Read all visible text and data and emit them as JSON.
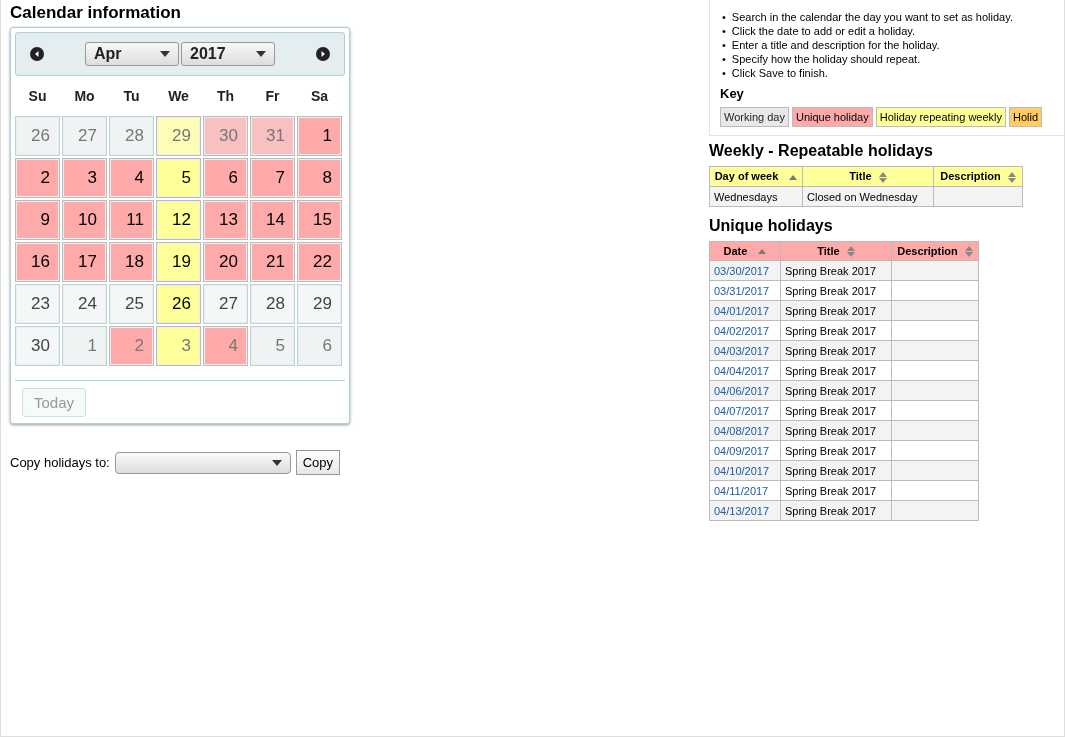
{
  "page_title": "Calendar information",
  "calendar": {
    "month": "Apr",
    "year": "2017",
    "weekdays": [
      "Su",
      "Mo",
      "Tu",
      "We",
      "Th",
      "Fr",
      "Sa"
    ],
    "weeks": [
      [
        {
          "day": "26",
          "kind": "working",
          "outside": true
        },
        {
          "day": "27",
          "kind": "working",
          "outside": true
        },
        {
          "day": "28",
          "kind": "working",
          "outside": true
        },
        {
          "day": "29",
          "kind": "weekly",
          "outside": true
        },
        {
          "day": "30",
          "kind": "unique",
          "outside": true
        },
        {
          "day": "31",
          "kind": "unique",
          "outside": true
        },
        {
          "day": "1",
          "kind": "unique",
          "outside": false
        }
      ],
      [
        {
          "day": "2",
          "kind": "unique",
          "outside": false
        },
        {
          "day": "3",
          "kind": "unique",
          "outside": false
        },
        {
          "day": "4",
          "kind": "unique",
          "outside": false
        },
        {
          "day": "5",
          "kind": "weekly",
          "outside": false
        },
        {
          "day": "6",
          "kind": "unique",
          "outside": false
        },
        {
          "day": "7",
          "kind": "unique",
          "outside": false
        },
        {
          "day": "8",
          "kind": "unique",
          "outside": false
        }
      ],
      [
        {
          "day": "9",
          "kind": "unique",
          "outside": false
        },
        {
          "day": "10",
          "kind": "unique",
          "outside": false
        },
        {
          "day": "11",
          "kind": "unique",
          "outside": false
        },
        {
          "day": "12",
          "kind": "weekly",
          "outside": false
        },
        {
          "day": "13",
          "kind": "unique",
          "outside": false
        },
        {
          "day": "14",
          "kind": "unique",
          "outside": false
        },
        {
          "day": "15",
          "kind": "unique",
          "outside": false
        }
      ],
      [
        {
          "day": "16",
          "kind": "unique",
          "outside": false
        },
        {
          "day": "17",
          "kind": "unique",
          "outside": false
        },
        {
          "day": "18",
          "kind": "unique",
          "outside": false
        },
        {
          "day": "19",
          "kind": "weekly",
          "outside": false
        },
        {
          "day": "20",
          "kind": "unique",
          "outside": false
        },
        {
          "day": "21",
          "kind": "unique",
          "outside": false
        },
        {
          "day": "22",
          "kind": "unique",
          "outside": false
        }
      ],
      [
        {
          "day": "23",
          "kind": "working",
          "outside": false
        },
        {
          "day": "24",
          "kind": "working",
          "outside": false
        },
        {
          "day": "25",
          "kind": "working",
          "outside": false
        },
        {
          "day": "26",
          "kind": "weekly",
          "outside": false
        },
        {
          "day": "27",
          "kind": "working",
          "outside": false
        },
        {
          "day": "28",
          "kind": "working",
          "outside": false
        },
        {
          "day": "29",
          "kind": "working",
          "outside": false
        }
      ],
      [
        {
          "day": "30",
          "kind": "working",
          "outside": false
        },
        {
          "day": "1",
          "kind": "working",
          "outside": true
        },
        {
          "day": "2",
          "kind": "unique",
          "outside": true
        },
        {
          "day": "3",
          "kind": "weekly",
          "outside": true
        },
        {
          "day": "4",
          "kind": "unique",
          "outside": true
        },
        {
          "day": "5",
          "kind": "working",
          "outside": true
        },
        {
          "day": "6",
          "kind": "working",
          "outside": true
        }
      ]
    ],
    "today_button": "Today"
  },
  "copy": {
    "label": "Copy holidays to:",
    "button": "Copy"
  },
  "hints": [
    {
      "bullet": "•",
      "text": "Search in the calendar the day you want to set as holiday."
    },
    {
      "bullet": "•",
      "text": "Click the date to add or edit a holiday."
    },
    {
      "bullet": "•",
      "text": "Enter a title and description for the holiday."
    },
    {
      "bullet": "•",
      "text": "Specify how the holiday should repeat."
    },
    {
      "bullet": "•",
      "text": "Click Save to finish."
    }
  ],
  "key": {
    "title": "Key",
    "items": [
      {
        "label": "Working day",
        "kind": "working"
      },
      {
        "label": "Unique holiday",
        "kind": "unique"
      },
      {
        "label": "Holiday repeating weekly",
        "kind": "weekly"
      },
      {
        "label": "Holid",
        "kind": "yearly"
      }
    ]
  },
  "weekly": {
    "title": "Weekly - Repeatable holidays",
    "columns": [
      {
        "label": "Day of week",
        "sorted": true
      },
      {
        "label": "Title",
        "sorted": false
      },
      {
        "label": "Description",
        "sorted": false
      }
    ],
    "rows": [
      [
        "Wednesdays",
        "Closed on Wednesday",
        ""
      ]
    ]
  },
  "unique": {
    "title": "Unique holidays",
    "columns": [
      {
        "label": "Date",
        "sorted": true
      },
      {
        "label": "Title",
        "sorted": false
      },
      {
        "label": "Description",
        "sorted": false
      }
    ],
    "rows": [
      {
        "date": "03/30/2017",
        "title": "Spring Break 2017"
      },
      {
        "date": "03/31/2017",
        "title": "Spring Break 2017"
      },
      {
        "date": "04/01/2017",
        "title": "Spring Break 2017"
      },
      {
        "date": "04/02/2017",
        "title": "Spring Break 2017"
      },
      {
        "date": "04/03/2017",
        "title": "Spring Break 2017"
      },
      {
        "date": "04/04/2017",
        "title": "Spring Break 2017"
      },
      {
        "date": "04/06/2017",
        "title": "Spring Break 2017"
      },
      {
        "date": "04/07/2017",
        "title": "Spring Break 2017"
      },
      {
        "date": "04/08/2017",
        "title": "Spring Break 2017"
      },
      {
        "date": "04/09/2017",
        "title": "Spring Break 2017"
      },
      {
        "date": "04/10/2017",
        "title": "Spring Break 2017"
      },
      {
        "date": "04/11/2017",
        "title": "Spring Break 2017"
      },
      {
        "date": "04/13/2017",
        "title": "Spring Break 2017"
      }
    ]
  }
}
